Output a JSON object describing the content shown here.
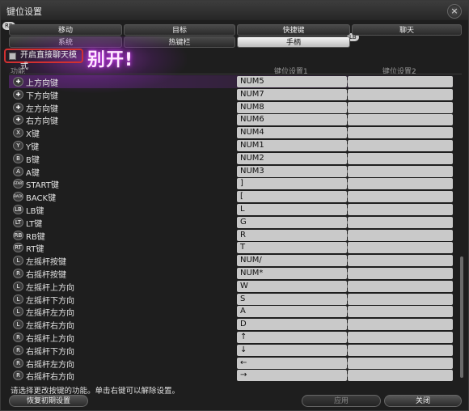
{
  "window": {
    "title": "键位设置",
    "close_symbol": "×"
  },
  "badges": {
    "rb": "RB",
    "lb": "LB"
  },
  "tabs_row1": [
    "移动",
    "目标",
    "快捷键",
    "聊天"
  ],
  "tabs_row2": [
    "系统",
    "热键栏",
    "手柄"
  ],
  "active_tab": "手柄",
  "toggle": {
    "label": "开启直接聊天模式"
  },
  "annotation": "别开!",
  "columns": {
    "function": "功能",
    "key1": "键位设置1",
    "key2": "键位设置2"
  },
  "rows": [
    {
      "icon": "dpad-up-icon",
      "glyph": "✚",
      "label": "上方向键",
      "key1": "NUM5"
    },
    {
      "icon": "dpad-down-icon",
      "glyph": "✚",
      "label": "下方向键",
      "key1": "NUM7"
    },
    {
      "icon": "dpad-left-icon",
      "glyph": "✚",
      "label": "左方向键",
      "key1": "NUM8"
    },
    {
      "icon": "dpad-right-icon",
      "glyph": "✚",
      "label": "右方向键",
      "key1": "NUM6"
    },
    {
      "icon": "x-button-icon",
      "glyph": "X",
      "label": "X键",
      "key1": "NUM4"
    },
    {
      "icon": "y-button-icon",
      "glyph": "Y",
      "label": "Y键",
      "key1": "NUM1"
    },
    {
      "icon": "b-button-icon",
      "glyph": "B",
      "label": "B键",
      "key1": "NUM2"
    },
    {
      "icon": "a-button-icon",
      "glyph": "A",
      "label": "A键",
      "key1": "NUM3"
    },
    {
      "icon": "start-button-icon",
      "glyph": "START",
      "label": "START键",
      "key1": "]"
    },
    {
      "icon": "back-button-icon",
      "glyph": "BACK",
      "label": "BACK键",
      "key1": "["
    },
    {
      "icon": "lb-button-icon",
      "glyph": "LB",
      "label": "LB键",
      "key1": "L"
    },
    {
      "icon": "lt-button-icon",
      "glyph": "LT",
      "label": "LT键",
      "key1": "G"
    },
    {
      "icon": "rb-button-icon",
      "glyph": "RB",
      "label": "RB键",
      "key1": "R"
    },
    {
      "icon": "rt-button-icon",
      "glyph": "RT",
      "label": "RT键",
      "key1": "T"
    },
    {
      "icon": "left-stick-press-icon",
      "glyph": "L",
      "label": "左摇杆按键",
      "key1": "NUM/"
    },
    {
      "icon": "right-stick-press-icon",
      "glyph": "R",
      "label": "右摇杆按键",
      "key1": "NUM*"
    },
    {
      "icon": "left-stick-icon",
      "glyph": "L",
      "label": "左摇杆上方向",
      "key1": "W"
    },
    {
      "icon": "left-stick-icon",
      "glyph": "L",
      "label": "左摇杆下方向",
      "key1": "S"
    },
    {
      "icon": "left-stick-icon",
      "glyph": "L",
      "label": "左摇杆左方向",
      "key1": "A"
    },
    {
      "icon": "left-stick-icon",
      "glyph": "L",
      "label": "左摇杆右方向",
      "key1": "D"
    },
    {
      "icon": "right-stick-icon",
      "glyph": "R",
      "label": "右摇杆上方向",
      "key1": "↑"
    },
    {
      "icon": "right-stick-icon",
      "glyph": "R",
      "label": "右摇杆下方向",
      "key1": "↓"
    },
    {
      "icon": "right-stick-icon",
      "glyph": "R",
      "label": "右摇杆左方向",
      "key1": "←"
    },
    {
      "icon": "right-stick-icon",
      "glyph": "R",
      "label": "右摇杆右方向",
      "key1": "→"
    }
  ],
  "hint": "请选择更改按键的功能。单击右键可以解除设置。",
  "buttons": {
    "reset": "恢复初期设置",
    "apply": "应用",
    "close": "关闭"
  },
  "colors": {
    "accent_highlight": "#d23030",
    "annotation_glow": "#c040e0",
    "key_cell": "#c9c9c9",
    "bg": "#1e1e1e"
  }
}
